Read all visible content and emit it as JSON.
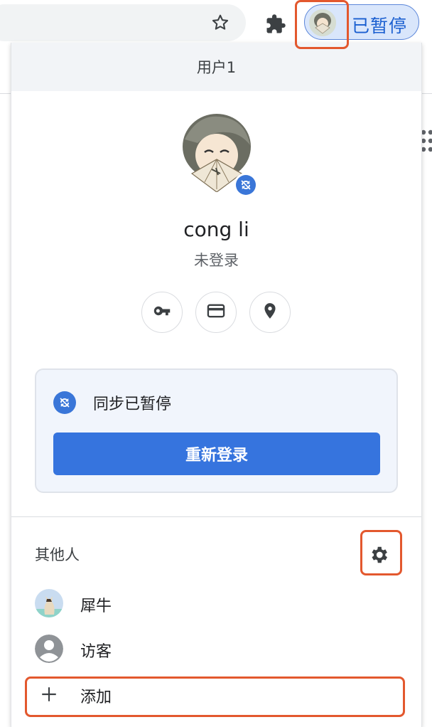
{
  "toolbar": {
    "star_icon": "star-outline-icon",
    "extensions_icon": "puzzle-icon",
    "profile_chip_label": "已暂停"
  },
  "panel": {
    "header": "用户1",
    "user_name": "cong li",
    "user_status": "未登录",
    "quick_actions": [
      "key-icon",
      "credit-card-icon",
      "location-pin-icon"
    ],
    "sync": {
      "status_text": "同步已暂停",
      "button_label": "重新登录"
    },
    "others": {
      "title": "其他人",
      "people": [
        {
          "name": "犀牛"
        },
        {
          "name": "访客"
        }
      ],
      "add_label": "添加"
    }
  },
  "colors": {
    "accent": "#3674de",
    "highlight": "#e3582e",
    "chip_bg": "#d9e6fb"
  }
}
